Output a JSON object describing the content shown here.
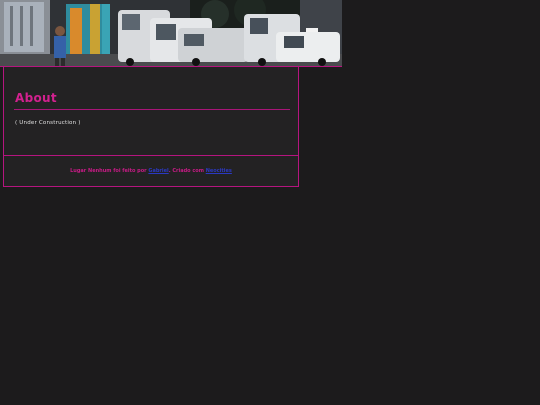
{
  "page": {
    "heading": "About",
    "status_text": "( Under Construction )"
  },
  "footer": {
    "prefix": "Lugar Nenhum foi feito por",
    "author_link": "Gabriel",
    "middle": ". Criado com",
    "tool_link": "Neocities"
  },
  "colors": {
    "background": "#1c1b1c",
    "panel": "#232223",
    "accent": "#b5157f",
    "heading": "#d2218f",
    "link": "#2b39c2"
  }
}
